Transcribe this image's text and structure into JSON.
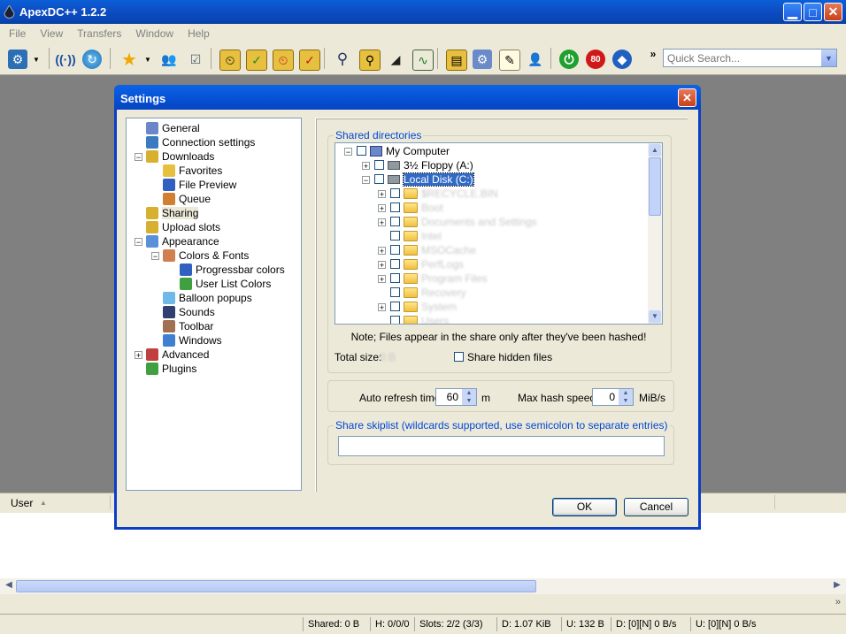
{
  "app": {
    "title": "ApexDC++ 1.2.2",
    "window_buttons": [
      "minimize-icon",
      "maximize-icon",
      "close-icon"
    ]
  },
  "menu": [
    "File",
    "View",
    "Transfers",
    "Window",
    "Help"
  ],
  "toolbar": {
    "overflow": "»",
    "icons": [
      "connect-icon",
      "reconnect-icon",
      "follow-redirect-icon",
      "favorites-icon",
      "favorite-users-icon",
      "recents-icon",
      "queue-icon",
      "finished-icon",
      "upload-queue-icon",
      "finished-uploads-icon",
      "search-icon",
      "adl-search-icon",
      "search-spy-icon",
      "network-stats-icon",
      "open-filelist-icon",
      "settings-icon",
      "notepad-icon",
      "users-icon",
      "away-icon",
      "limiter-icon",
      "apexdc-icon"
    ],
    "limiter_value": "80"
  },
  "quick_search": {
    "placeholder": "Quick Search..."
  },
  "dialog": {
    "title": "Settings",
    "tree": [
      {
        "label": "General",
        "level": 0
      },
      {
        "label": "Connection settings",
        "level": 0
      },
      {
        "label": "Downloads",
        "level": 0,
        "expander": "−"
      },
      {
        "label": "Favorites",
        "level": 1
      },
      {
        "label": "File Preview",
        "level": 1
      },
      {
        "label": "Queue",
        "level": 1
      },
      {
        "label": "Sharing",
        "level": 0,
        "selected": true
      },
      {
        "label": "Upload slots",
        "level": 0
      },
      {
        "label": "Appearance",
        "level": 0,
        "expander": "−"
      },
      {
        "label": "Colors & Fonts",
        "level": 1,
        "expander": "−"
      },
      {
        "label": "Progressbar colors",
        "level": 2
      },
      {
        "label": "User List Colors",
        "level": 2
      },
      {
        "label": "Balloon popups",
        "level": 1
      },
      {
        "label": "Sounds",
        "level": 1
      },
      {
        "label": "Toolbar",
        "level": 1
      },
      {
        "label": "Windows",
        "level": 1
      },
      {
        "label": "Advanced",
        "level": 0,
        "expander": "+"
      },
      {
        "label": "Plugins",
        "level": 0
      }
    ],
    "shared_directories": {
      "legend": "Shared directories",
      "rows": [
        {
          "label": "My Computer",
          "indent": 0,
          "expander": "−"
        },
        {
          "label": "3½ Floppy (A:)",
          "indent": 1,
          "expander": "+"
        },
        {
          "label": "Local Disk (C:)",
          "indent": 1,
          "expander": "−",
          "selected": true
        },
        {
          "label": "$RECYCLE.BIN",
          "indent": 2,
          "expander": "+",
          "blurred": true
        },
        {
          "label": "Boot",
          "indent": 2,
          "expander": "+",
          "blurred": true
        },
        {
          "label": "Documents and Settings",
          "indent": 2,
          "expander": "+",
          "blurred": true
        },
        {
          "label": "Intel",
          "indent": 2,
          "expander": "",
          "blurred": true
        },
        {
          "label": "MSOCache",
          "indent": 2,
          "expander": "+",
          "blurred": true
        },
        {
          "label": "PerfLogs",
          "indent": 2,
          "expander": "+",
          "blurred": true
        },
        {
          "label": "Program Files",
          "indent": 2,
          "expander": "+",
          "blurred": true
        },
        {
          "label": "Recovery",
          "indent": 2,
          "expander": "",
          "blurred": true
        },
        {
          "label": "System",
          "indent": 2,
          "expander": "+",
          "blurred": true
        },
        {
          "label": "Users",
          "indent": 2,
          "expander": "",
          "blurred": true
        }
      ],
      "note": "Note; Files appear in the share only after they've been hashed!",
      "total_size_label": "Total size:",
      "total_size_value": "0 B",
      "share_hidden_label": "Share hidden files"
    },
    "refresh": {
      "auto_refresh_label": "Auto refresh time",
      "auto_refresh_value": "60",
      "auto_refresh_unit": "m",
      "max_hash_label": "Max hash speed",
      "max_hash_value": "0",
      "max_hash_unit": "MiB/s"
    },
    "skiplist": {
      "legend": "Share skiplist (wildcards supported, use semicolon to separate entries)",
      "value": ""
    },
    "ok_label": "OK",
    "cancel_label": "Cancel"
  },
  "userlist": {
    "column_user": "User"
  },
  "status": {
    "shared": "Shared: 0 B",
    "hubs": "H: 0/0/0",
    "slots": "Slots: 2/2 (3/3)",
    "downloaded": "D: 1.07 KiB",
    "uploaded": "U: 132 B",
    "download_rate": "D: [0][N] 0 B/s",
    "upload_rate": "U: [0][N] 0 B/s"
  }
}
